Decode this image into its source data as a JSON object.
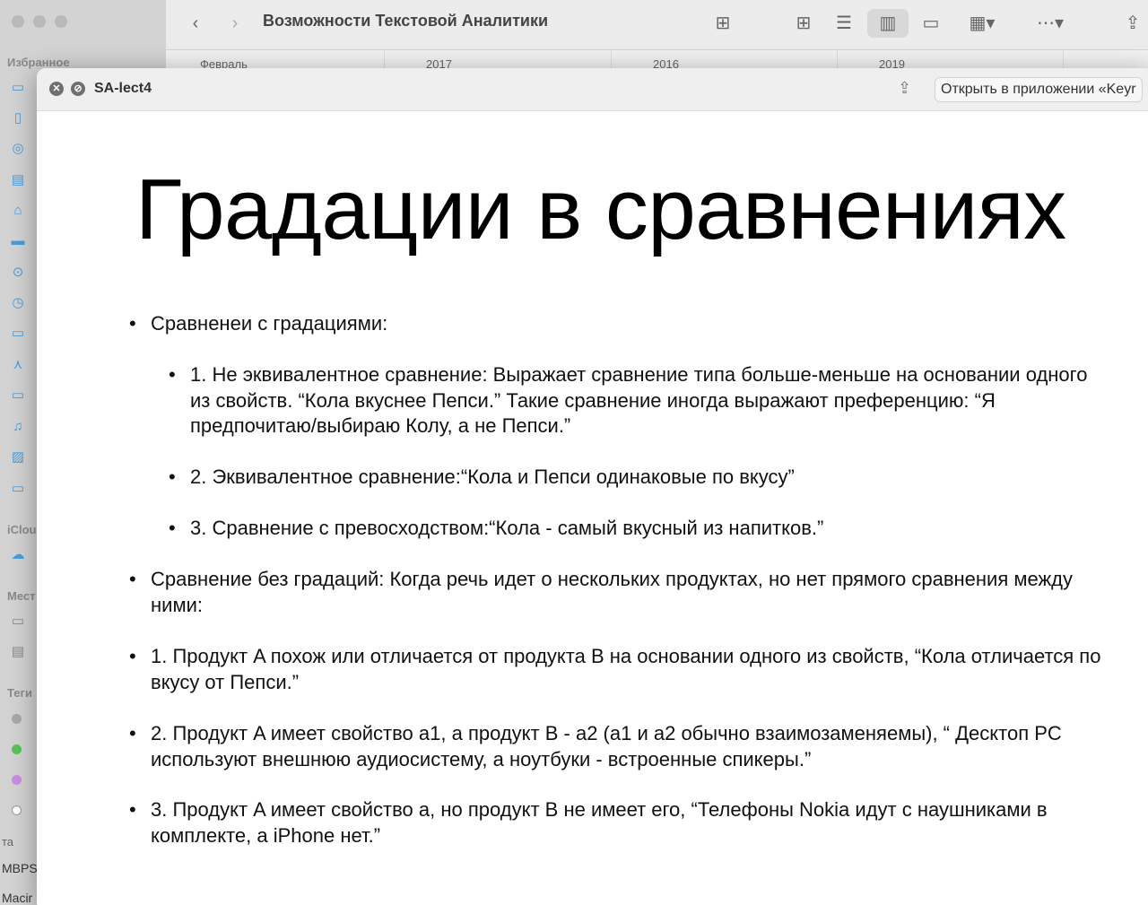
{
  "finder": {
    "title": "Возможности Текстовой Аналитики",
    "sidebar": {
      "favorites_label": "Избранное",
      "icloud_label": "iClou",
      "locations_label": "Мест",
      "tags_label": "Теги",
      "bottom_label": "та",
      "device1": "MBPS",
      "device2": "Macir"
    },
    "columns": [
      "Февраль",
      "2017",
      "2016",
      "2019"
    ]
  },
  "quicklook": {
    "filename": "SA-lect4",
    "open_button": "Открыть в приложении «Keyr",
    "close_glyph": "✕",
    "fullscreen_glyph": "⊘"
  },
  "slide": {
    "title": "Градации в сравнениях",
    "bullets": [
      "Сравненеи с градациями:",
      "1. Не эквивалентное сравнение: Выражает сравнение типа больше-меньше на основании одного из свойств. “Кола вкуснее Пепси.” Такие сравнение иногда выражают преференцию: “Я предпочитаю/выбираю Колу, а не Пепси.”",
      "2. Эквивалентное сравнение:“Кола и Пепси одинаковые по вкусу”",
      "3. Сравнение с превосходством:“Кола - самый вкусный из напитков.”",
      "Сравнение без градаций: Когда речь идет о нескольких продуктах, но нет прямого сравнения между ними:",
      "1. Продукт A похож или отличается от продукта B на основании одного из свойств, “Кола отличается по вкусу от Пепси.”",
      "2. Продукт A имеет свойство a1, а продукт B - a2 (a1 и a2 обычно взаимозаменяемы), “ Десктоп PC используют внешнюю аудиосистему, а ноутбуки - встроенные спикеры.”",
      "3. Продукт A имеет свойство a, но продукт B не имеет его, “Телефоны Nokia идут с наушниками в комплекте, а iPhone нет.”"
    ]
  },
  "colors": {
    "accent": "#4a9cd8",
    "tag_green": "#5bc35b",
    "tag_purple": "#c98ee0",
    "tag_gray": "#a8a8a8"
  }
}
